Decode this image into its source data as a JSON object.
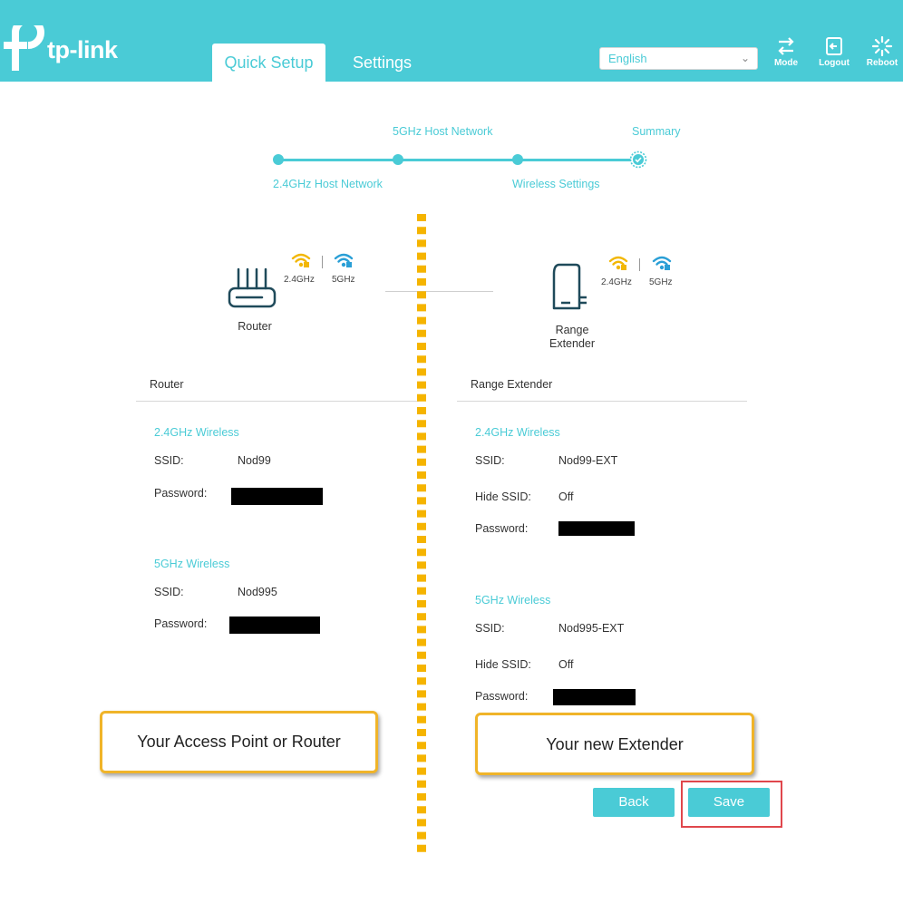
{
  "header": {
    "brand": "tp-link",
    "tabs": [
      {
        "label": "Quick Setup",
        "active": true
      },
      {
        "label": "Settings",
        "active": false
      }
    ],
    "language": "English",
    "buttons": [
      {
        "label": "Mode",
        "icon": "mode-icon"
      },
      {
        "label": "Logout",
        "icon": "logout-icon"
      },
      {
        "label": "Reboot",
        "icon": "reboot-icon"
      }
    ],
    "accent_color": "#4acbd6"
  },
  "stepper": {
    "steps": [
      "2.4GHz Host Network",
      "5GHz Host Network",
      "Wireless Settings",
      "Summary"
    ]
  },
  "devices": {
    "router": {
      "label": "Router",
      "band_24": "2.4GHz",
      "band_5": "5GHz"
    },
    "extender": {
      "label_line1": "Range",
      "label_line2": "Extender",
      "band_24": "2.4GHz",
      "band_5": "5GHz"
    }
  },
  "router_panel": {
    "title": "Router",
    "wireless_24": {
      "heading": "2.4GHz Wireless",
      "ssid_label": "SSID:",
      "ssid": "Nod99",
      "password_label": "Password:"
    },
    "wireless_5": {
      "heading": "5GHz Wireless",
      "ssid_label": "SSID:",
      "ssid": "Nod995",
      "password_label": "Password:"
    }
  },
  "extender_panel": {
    "title": "Range Extender",
    "wireless_24": {
      "heading": "2.4GHz Wireless",
      "ssid_label": "SSID:",
      "ssid": "Nod99-EXT",
      "hide_label": "Hide SSID:",
      "hide_value": "Off",
      "password_label": "Password:"
    },
    "wireless_5": {
      "heading": "5GHz Wireless",
      "ssid_label": "SSID:",
      "ssid": "Nod995-EXT",
      "hide_label": "Hide SSID:",
      "hide_value": "Off",
      "password_label": "Password:"
    }
  },
  "callouts": {
    "left": "Your Access Point or Router",
    "right": "Your new Extender"
  },
  "actions": {
    "back": "Back",
    "save": "Save"
  }
}
